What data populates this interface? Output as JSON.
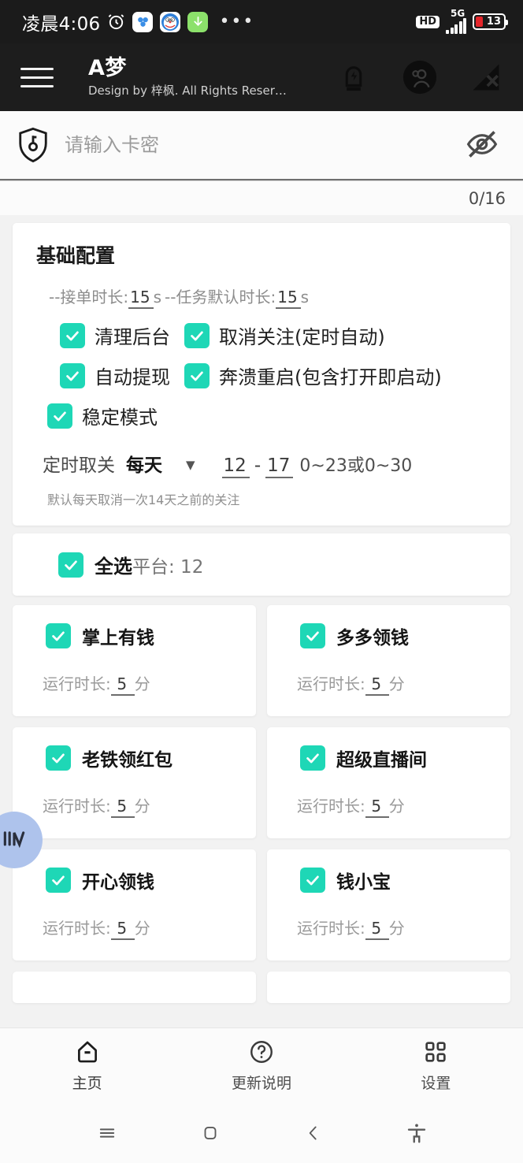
{
  "statusbar": {
    "time": "凌晨4:06",
    "alarm_icon": "alarm-clock-icon",
    "apps": [
      "cloud-app-icon",
      "doraemon-app-icon",
      "download-app-icon"
    ],
    "overflow": "•••",
    "hd": "HD",
    "network": "5G",
    "battery_level": "13"
  },
  "appbar": {
    "menu_icon": "hamburger-menu-icon",
    "title": "A梦",
    "subtitle": "Design by 梓枫. All Rights Reser…",
    "icons": [
      "battery-boost-icon",
      "account-icon",
      "signal-off-icon"
    ]
  },
  "keyfield": {
    "shield_icon": "shield-key-icon",
    "placeholder": "请输入卡密",
    "value": "",
    "toggle_icon": "eye-off-icon",
    "counter": "0/16"
  },
  "basic": {
    "title": "基础配置",
    "duration_prefix": "--接单时长:",
    "order_duration": "15",
    "unit_s": "s",
    "duration_mid": "--任务默认时长:",
    "task_duration": "15",
    "unit_s2": "s",
    "checkboxes": [
      {
        "label": "清理后台",
        "checked": true
      },
      {
        "label": "取消关注(定时自动)",
        "checked": true
      },
      {
        "label": "自动提现",
        "checked": true
      },
      {
        "label": "奔溃重启(包含打开即启动)",
        "checked": true
      },
      {
        "label": "稳定模式",
        "checked": true
      }
    ],
    "schedule_label": "定时取关",
    "schedule_value": "每天",
    "schedule_caret": "chevron-down-icon",
    "schedule_from": "12",
    "schedule_dash": "-",
    "schedule_to": "17",
    "schedule_range_hint": "0~23或0~30",
    "schedule_note": "默认每天取消一次14天之前的关注"
  },
  "select_all": {
    "checked": true,
    "label_bold": "全选",
    "label_gray": "平台: 12"
  },
  "platforms": [
    {
      "name": "掌上有钱",
      "checked": true,
      "dur_label": "运行时长:",
      "dur_value": "5",
      "dur_unit": "分"
    },
    {
      "name": "多多领钱",
      "checked": true,
      "dur_label": "运行时长:",
      "dur_value": "5",
      "dur_unit": "分"
    },
    {
      "name": "老铁领红包",
      "checked": true,
      "dur_label": "运行时长:",
      "dur_value": "5",
      "dur_unit": "分"
    },
    {
      "name": "超级直播间",
      "checked": true,
      "dur_label": "运行时长:",
      "dur_value": "5",
      "dur_unit": "分"
    },
    {
      "name": "开心领钱",
      "checked": true,
      "dur_label": "运行时长:",
      "dur_value": "5",
      "dur_unit": "分"
    },
    {
      "name": "钱小宝",
      "checked": true,
      "dur_label": "运行时长:",
      "dur_value": "5",
      "dur_unit": "分"
    }
  ],
  "floating_widget": {
    "icon": "auto-js-logo-icon",
    "color": "#aec3ec"
  },
  "tabs": [
    {
      "label": "主页",
      "icon": "home-icon",
      "active": true
    },
    {
      "label": "更新说明",
      "icon": "question-circle-icon",
      "active": false
    },
    {
      "label": "设置",
      "icon": "grid-icon",
      "active": false
    }
  ],
  "navbar": [
    "recents-icon",
    "home-square-icon",
    "back-icon",
    "accessibility-icon"
  ],
  "colors": {
    "accent": "#1ed7b6",
    "appbar": "#1d1d1d",
    "battery_red": "#e5262b"
  }
}
